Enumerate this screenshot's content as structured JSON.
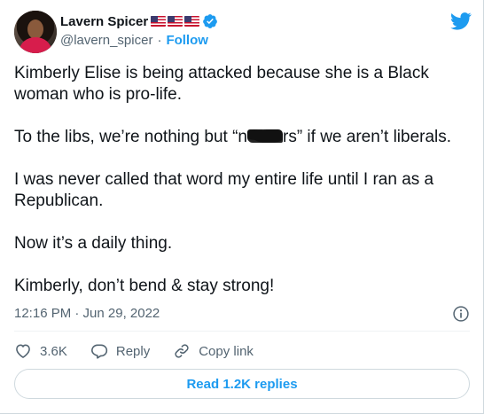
{
  "author": {
    "name": "Lavern Spicer",
    "flags": [
      "us-flag",
      "us-flag",
      "us-flag"
    ],
    "handle": "@lavern_spicer",
    "follow_label": "Follow",
    "separator": "·"
  },
  "tweet": {
    "paragraphs": [
      "Kimberly Elise is being attacked because she is a Black woman who is pro-life.",
      "To the libs, we’re nothing but “n",
      "I was never called that word my entire life until I ran as a Republican.",
      "Now it’s a daily thing.",
      "Kimberly, don’t bend & stay strong!"
    ],
    "censored_tail": "rs” if we aren’t liberals."
  },
  "timestamp": "12:16 PM · Jun 29, 2022",
  "actions": {
    "like_count": "3.6K",
    "reply_label": "Reply",
    "copy_label": "Copy link"
  },
  "read_replies_label": "Read 1.2K replies",
  "colors": {
    "accent": "#1d9bf0",
    "text": "#0f1419",
    "muted": "#536471"
  },
  "icons": [
    "twitter-bird-icon",
    "verified-badge-icon",
    "info-icon",
    "heart-icon",
    "reply-icon",
    "link-icon"
  ]
}
